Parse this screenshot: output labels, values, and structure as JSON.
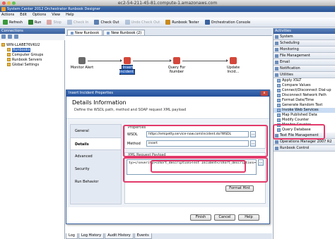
{
  "mac": {
    "title": "ec2-54-211-45-81.compute-1.amazonaws.com"
  },
  "window": {
    "title": "System Center 2012 Orchestrator Runbook Designer"
  },
  "menu": [
    "Actions",
    "Edit",
    "Options",
    "View",
    "Help"
  ],
  "toolbar": [
    {
      "label": "Refresh",
      "icon": "refresh-icon",
      "disabled": false,
      "color": "#3a9a3a"
    },
    {
      "label": "Run",
      "icon": "run-icon",
      "disabled": false,
      "color": "#2f7d2f"
    },
    {
      "label": "Stop",
      "icon": "stop-icon",
      "disabled": true,
      "color": "#c43c2c"
    },
    {
      "label": "Check In",
      "icon": "check-in-icon",
      "disabled": true,
      "color": "#5a7fb0"
    },
    {
      "label": "Check Out",
      "icon": "check-out-icon",
      "disabled": false,
      "color": "#5a7fb0"
    },
    {
      "label": "Undo Check Out",
      "icon": "undo-check-out-icon",
      "disabled": true,
      "color": "#5a7fb0"
    },
    {
      "label": "Runbook Tester",
      "icon": "runbook-tester-icon",
      "disabled": false,
      "color": "#c98a1e"
    },
    {
      "label": "Orchestration Console",
      "icon": "console-icon",
      "disabled": false,
      "color": "#3b62a0"
    }
  ],
  "connections": {
    "header": "Connections",
    "tree": [
      {
        "label": "WIN-LLABE76VKU2",
        "level": 0,
        "selected": false
      },
      {
        "label": "Runbooks",
        "level": 1,
        "selected": true
      },
      {
        "label": "Computer Groups",
        "level": 1,
        "selected": false
      },
      {
        "label": "Runbook Servers",
        "level": 1,
        "selected": false
      },
      {
        "label": "Global Settings",
        "level": 1,
        "selected": false
      }
    ]
  },
  "doc_tabs": [
    {
      "label": "New Runbook",
      "active": true
    },
    {
      "label": "New Runbook (2)",
      "active": false
    }
  ],
  "workflow": [
    {
      "label": "Monitor Alert",
      "color": "#6a6a6a",
      "selected": false
    },
    {
      "label": "Insert Incident",
      "color": "#d3473a",
      "selected": true
    },
    {
      "label": "Query For Number",
      "color": "#d3473a",
      "selected": false
    },
    {
      "label": "Update Incid...",
      "color": "#d3473a",
      "selected": false
    }
  ],
  "bottom_tabs": [
    {
      "label": "Log",
      "active": true
    },
    {
      "label": "Log History",
      "active": false
    },
    {
      "label": "Audit History",
      "active": false
    },
    {
      "label": "Events",
      "active": false
    }
  ],
  "activities": {
    "header": "Activities",
    "top_categories": [
      "System",
      "Scheduling",
      "Monitoring",
      "File Management",
      "Email",
      "Notification"
    ],
    "utilities_label": "Utilities",
    "utilities_items": [
      {
        "label": "Apply XSLT",
        "highlight": false
      },
      {
        "label": "Compare Values",
        "highlight": false
      },
      {
        "label": "Connect/Disconnect Dial-up",
        "highlight": false
      },
      {
        "label": "Disconnect Network Path",
        "highlight": false
      },
      {
        "label": "Format Date/Time",
        "highlight": false
      },
      {
        "label": "Generate Random Text",
        "highlight": false
      },
      {
        "label": "Invoke Web Services",
        "highlight": true
      },
      {
        "label": "Map Published Data",
        "highlight": false
      },
      {
        "label": "Modify Counter",
        "highlight": false
      },
      {
        "label": "Monitor Counter",
        "highlight": false
      },
      {
        "label": "Query Database",
        "highlight": false
      }
    ],
    "bottom_categories": [
      "Text File Management",
      "Operations Manager 2007 R2",
      "Runbook Control"
    ]
  },
  "dialog": {
    "title": "Insert Incident Properties",
    "close": "x",
    "heading": "Details Information",
    "subheading": "Define the WSDL path, method and SOAP request XML payload",
    "nav": [
      {
        "label": "General",
        "selected": false
      },
      {
        "label": "Details",
        "selected": true
      },
      {
        "label": "Advanced",
        "selected": false
      },
      {
        "label": "Security",
        "selected": false
      },
      {
        "label": "Run Behavior",
        "selected": false
      }
    ],
    "properties_caption": "Properties",
    "wsdl_label": "WSDL",
    "wsdl_value": "https://emipetty.service-now.com/incident.do?WSDL",
    "method_label": "Method",
    "method_value": "insert",
    "browse_label": "...",
    "xml_caption": "XML Request Payload",
    "xml_value": "ty></severity><short_description>Test Incident</short_description></urls></",
    "format_hint": "Format Hint",
    "finish": "Finish",
    "cancel": "Cancel",
    "help": "Help"
  }
}
